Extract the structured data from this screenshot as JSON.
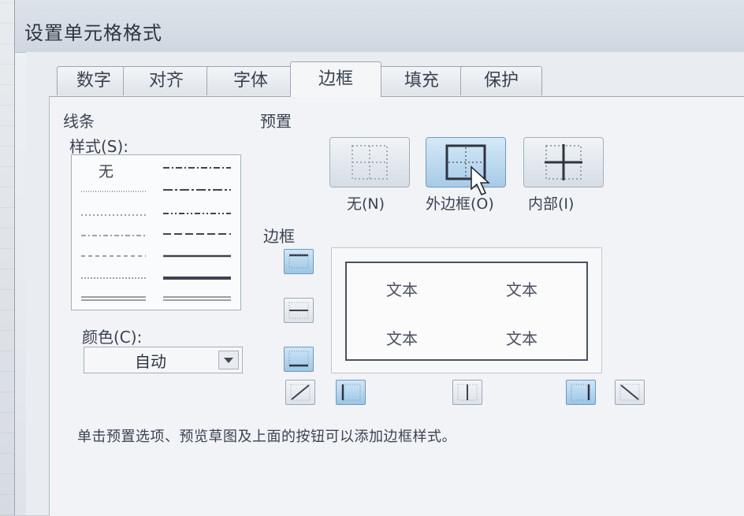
{
  "dialog": {
    "title": "设置单元格格式"
  },
  "tabs": [
    {
      "label": "数字",
      "active": false
    },
    {
      "label": "对齐",
      "active": false
    },
    {
      "label": "字体",
      "active": false
    },
    {
      "label": "边框",
      "active": true
    },
    {
      "label": "填充",
      "active": false
    },
    {
      "label": "保护",
      "active": false
    }
  ],
  "line": {
    "section_label": "线条",
    "style_label": "样式(S):",
    "none_label": "无",
    "color_label": "颜色(C):",
    "color_value": "自动"
  },
  "presets": {
    "section_label": "预置",
    "items": [
      {
        "label": "无(N)",
        "icon": "border-none-icon"
      },
      {
        "label": "外边框(O)",
        "icon": "border-outline-icon",
        "selected": true
      },
      {
        "label": "内部(I)",
        "icon": "border-inside-icon"
      }
    ]
  },
  "border": {
    "section_label": "边框",
    "preview_texts": [
      "文本",
      "文本",
      "文本",
      "文本"
    ]
  },
  "hint": "单击预置选项、预览草图及上面的按钮可以添加边框样式。",
  "colors": {
    "selected": "#a6cbe7",
    "line": "#4b5260"
  }
}
